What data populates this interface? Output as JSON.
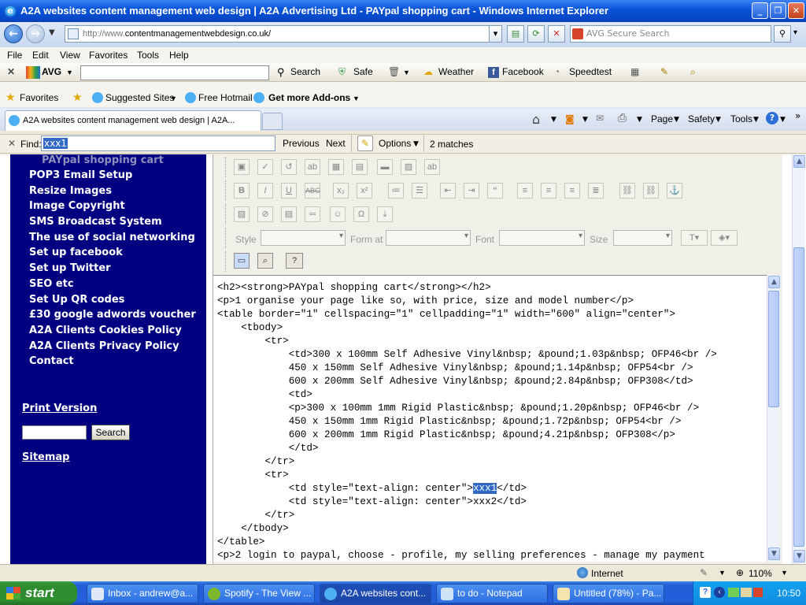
{
  "window": {
    "title": "A2A websites content management web design | A2A Advertising Ltd - PAYpal shopping cart - Windows Internet Explorer"
  },
  "address": {
    "prefix": "http://www.",
    "domain": "contentmanagementwebdesign.co.uk/"
  },
  "search": {
    "placeholder": "AVG Secure Search"
  },
  "menu": {
    "file": "File",
    "edit": "Edit",
    "view": "View",
    "favorites": "Favorites",
    "tools": "Tools",
    "help": "Help"
  },
  "avg_toolbar": {
    "brand": "AVG",
    "search": "Search",
    "safe": "Safe",
    "weather": "Weather",
    "facebook": "Facebook",
    "speedtest": "Speedtest"
  },
  "favorites_bar": {
    "favorites": "Favorites",
    "suggested": "Suggested Sites",
    "hotmail": "Free Hotmail",
    "addons": "Get more Add-ons"
  },
  "tab": {
    "title": "A2A websites content management web design | A2A..."
  },
  "command_bar": {
    "page": "Page",
    "safety": "Safety",
    "tools": "Tools"
  },
  "find": {
    "label": "Find:",
    "query": "xxx1",
    "previous": "Previous",
    "next": "Next",
    "options": "Options",
    "matches": "2 matches"
  },
  "sidebar": {
    "current": "PAYpal shopping cart",
    "items": [
      "POP3 Email Setup",
      "Resize Images",
      "Image Copyright",
      "SMS Broadcast System",
      "The use of social networking",
      "Set up facebook",
      "Set up Twitter",
      "SEO etc",
      "Set Up QR codes",
      "£30 google adwords voucher",
      "A2A Clients Cookies Policy",
      "A2A Clients Privacy Policy",
      "Contact"
    ],
    "print_version": "Print Version",
    "search_button": "Search",
    "sitemap": "Sitemap"
  },
  "editor": {
    "style_label": "Style",
    "format_label": "Form at",
    "font_label": "Font",
    "size_label": "Size",
    "code_lines": [
      "<h2><strong>PAYpal shopping cart</strong></h2>",
      "<p>1 organise your page like so, with price, size and model number</p>",
      "<table border=\"1\" cellspacing=\"1\" cellpadding=\"1\" width=\"600\" align=\"center\">",
      "    <tbody>",
      "        <tr>",
      "            <td>300 x 100mm Self Adhesive Vinyl&nbsp; &pound;1.03p&nbsp; OFP46<br />",
      "            450 x 150mm Self Adhesive Vinyl&nbsp; &pound;1.14p&nbsp; OFP54<br />",
      "            600 x 200mm Self Adhesive Vinyl&nbsp; &pound;2.84p&nbsp; OFP308</td>",
      "            <td>",
      "            <p>300 x 100mm 1mm Rigid Plastic&nbsp; &pound;1.20p&nbsp; OFP46<br />",
      "            450 x 150mm 1mm Rigid Plastic&nbsp; &pound;1.72p&nbsp; OFP54<br />",
      "            600 x 200mm 1mm Rigid Plastic&nbsp; &pound;4.21p&nbsp; OFP308</p>",
      "            </td>",
      "        </tr>",
      "        <tr>",
      "            <td style=\"text-align: center\">",
      "            <td style=\"text-align: center\">xxx2</td>",
      "        </tr>",
      "    </tbody>",
      "</table>",
      "<p>2 login to paypal, choose - profile, my selling preferences - manage my payment"
    ],
    "match_text": "xxx1",
    "match_suffix": "</td>"
  },
  "statusbar": {
    "zone": "Internet",
    "zoom": "110%"
  },
  "taskbar": {
    "start": "start",
    "buttons": [
      "Inbox - andrew@a...",
      "Spotify - The View ...",
      "A2A websites cont...",
      "to do - Notepad",
      "Untitled (78%) - Pa..."
    ],
    "clock": "10:50"
  }
}
